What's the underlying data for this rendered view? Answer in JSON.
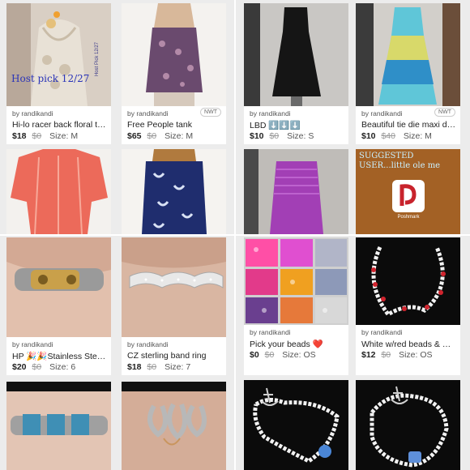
{
  "quadrants": [
    {
      "name": "top-left",
      "cards": [
        {
          "seller": "by randikandi",
          "badge": "",
          "title": "Hi-lo racer back floral top...",
          "price": "$18",
          "original": "$0",
          "size": "Size: M",
          "overlay": "Host pick 12/27",
          "photo": "lace-top"
        },
        {
          "seller": "by randikandi",
          "badge": "NWT",
          "title": "Free People tank",
          "price": "$65",
          "original": "$0",
          "size": "Size: M",
          "photo": "paisley-tank"
        },
        {
          "photo": "coral-top"
        },
        {
          "photo": "blue-print-top"
        }
      ]
    },
    {
      "name": "top-right",
      "cards": [
        {
          "seller": "by randikandi",
          "badge": "",
          "title": "LBD ⬇️⬇️⬇️",
          "price": "$10",
          "original": "$0",
          "size": "Size: S",
          "photo": "black-dress"
        },
        {
          "seller": "by randikandi",
          "badge": "NWT",
          "title": "Beautiful tie die maxi dre...",
          "price": "$10",
          "original": "$40",
          "size": "Size: M",
          "photo": "tie-dye-dress"
        },
        {
          "photo": "purple-dress"
        },
        {
          "overlay": "SUGGESTED USER...little ole me",
          "logo_caption": "Poshmark",
          "photo": "suggested-user"
        }
      ]
    },
    {
      "name": "bottom-left",
      "cards": [
        {
          "seller": "by randikandi",
          "badge": "",
          "title": "HP 🎉🎉Stainless Steel...",
          "price": "$20",
          "original": "$0",
          "size": "Size: 6",
          "photo": "steel-ring"
        },
        {
          "seller": "by randikandi",
          "badge": "",
          "title": "CZ sterling band ring",
          "price": "$18",
          "original": "$0",
          "size": "Size: 7",
          "photo": "cz-ring"
        },
        {
          "photo": "blue-stone-ring"
        },
        {
          "photo": "swirl-ring"
        }
      ]
    },
    {
      "name": "bottom-right",
      "cards": [
        {
          "seller": "by randikandi",
          "badge": "",
          "title": "Pick your beads ❤️",
          "price": "$0",
          "original": "$0",
          "size": "Size: OS",
          "photo": "beads"
        },
        {
          "seller": "by randikandi",
          "badge": "",
          "title": "White w/red beads & ⚓...",
          "price": "$12",
          "original": "$0",
          "size": "Size: OS",
          "photo": "red-bead-bracelet"
        },
        {
          "photo": "anchor-bracelet-1"
        },
        {
          "photo": "anchor-bracelet-2"
        }
      ]
    }
  ],
  "colors": {
    "background": "#ececec",
    "card": "#ffffff",
    "strike": "#999999"
  }
}
